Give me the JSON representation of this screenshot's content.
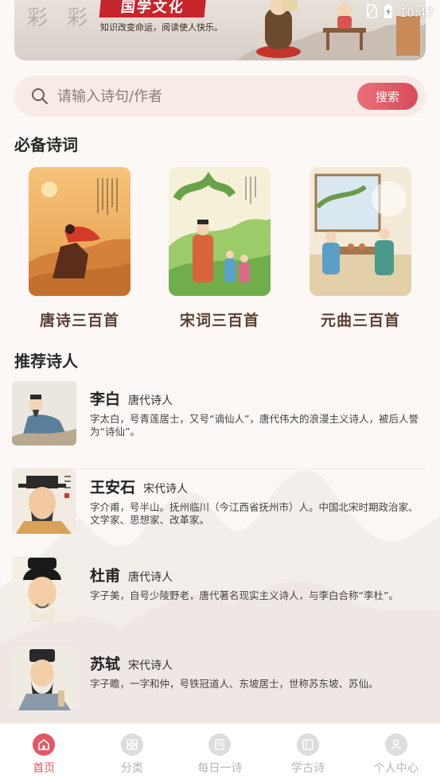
{
  "status_bar": {
    "time": "10:47"
  },
  "banner": {
    "title": "国学文化",
    "slogan": "知识改变命运，阅读使人快乐。"
  },
  "search": {
    "placeholder": "请输入诗句/作者",
    "button_label": "搜索"
  },
  "essentials": {
    "title": "必备诗词",
    "books": [
      {
        "label": "唐诗三百首"
      },
      {
        "label": "宋词三百首"
      },
      {
        "label": "元曲三百首"
      }
    ]
  },
  "poets": {
    "title": "推荐诗人",
    "items": [
      {
        "name": "李白",
        "era": "唐代诗人",
        "desc": "字太白，号青莲居士，又号“谪仙人”，唐代伟大的浪漫主义诗人，被后人誉为“诗仙”。"
      },
      {
        "name": "王安石",
        "era": "宋代诗人",
        "desc": "字介甫，号半山。抚州临川（今江西省抚州市）人。中国北宋时期政治家、文学家、思想家、改革家。"
      },
      {
        "name": "杜甫",
        "era": "唐代诗人",
        "desc": "字子美，自号少陵野老，唐代著名现实主义诗人，与李白合称“李杜”。"
      },
      {
        "name": "苏轼",
        "era": "宋代诗人",
        "desc": "字子瞻，一字和仲，号铁冠道人、东坡居士，世称苏东坡、苏仙。"
      }
    ]
  },
  "tabs": [
    {
      "label": "首页",
      "icon": "home-icon",
      "active": true
    },
    {
      "label": "分类",
      "icon": "grid-icon",
      "active": false
    },
    {
      "label": "每日一诗",
      "icon": "document-icon",
      "active": false
    },
    {
      "label": "学古诗",
      "icon": "book-icon",
      "active": false
    },
    {
      "label": "个人中心",
      "icon": "user-icon",
      "active": false
    }
  ],
  "colors": {
    "accent": "#e55762",
    "search_bg": "#f8ebe5",
    "background": "#fdf8f6"
  }
}
